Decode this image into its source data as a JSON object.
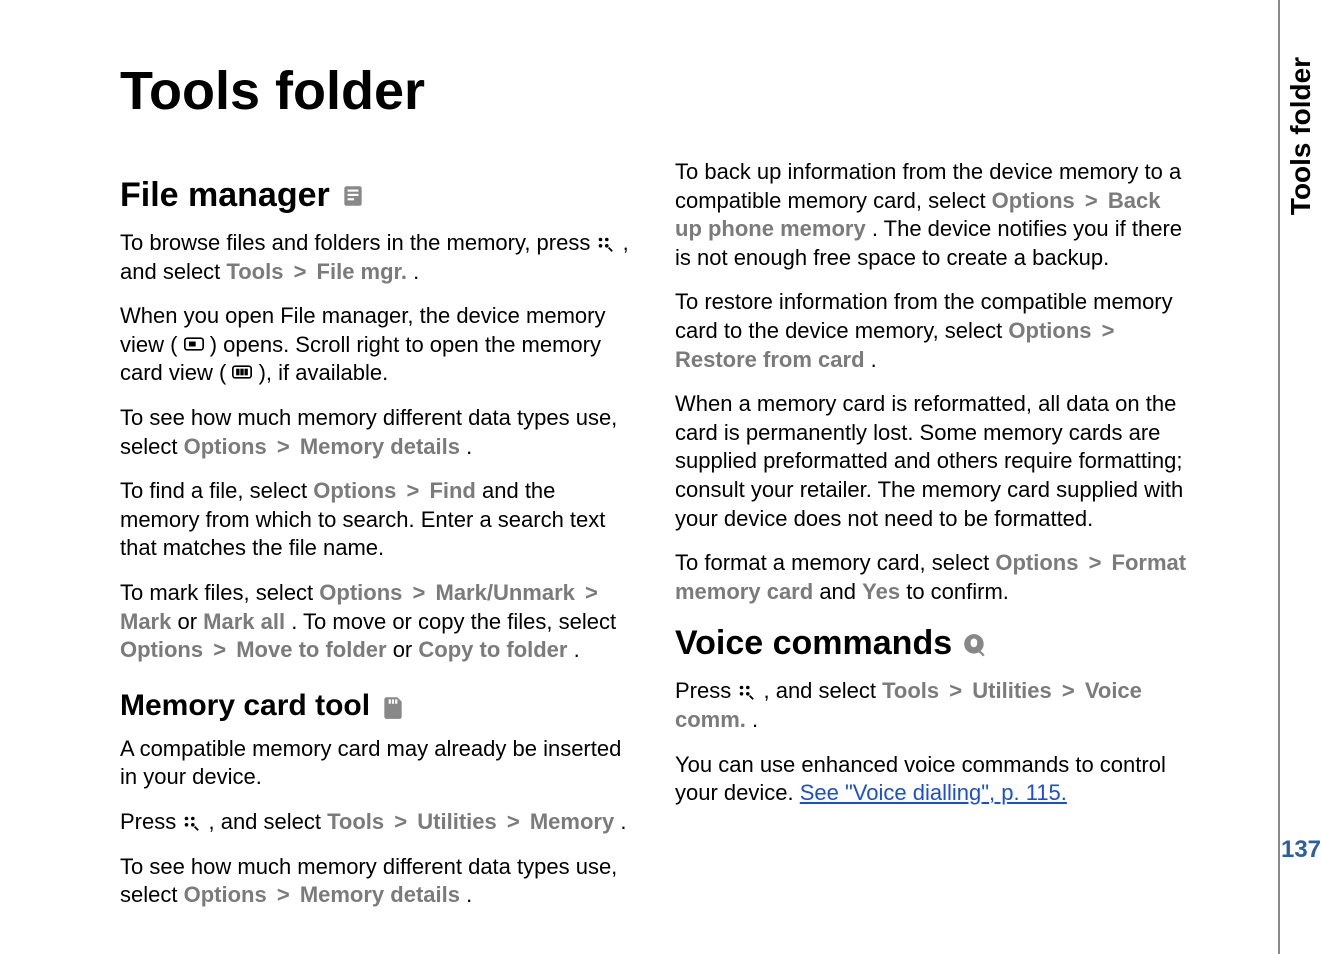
{
  "sidebar": {
    "label": "Tools folder",
    "page_number": "137"
  },
  "title": "Tools folder",
  "sections": {
    "file_manager": {
      "heading": "File manager"
    },
    "memory_card": {
      "heading": "Memory card tool"
    },
    "voice_commands": {
      "heading": "Voice commands"
    }
  },
  "menu": {
    "options": "Options",
    "tools": "Tools",
    "file_mgr": "File mgr.",
    "memory_details": "Memory details",
    "find": "Find",
    "mark_unmark": "Mark/Unmark",
    "mark": "Mark",
    "mark_all": "Mark all",
    "move_to_folder": "Move to folder",
    "copy_to_folder": "Copy to folder",
    "utilities": "Utilities",
    "memory": "Memory",
    "back_up_phone_memory": "Back up phone memory",
    "restore_from_card": "Restore from card",
    "format_memory_card": "Format memory card",
    "yes": "Yes",
    "voice_comm": "Voice comm."
  },
  "text": {
    "fm_p1a": "To browse files and folders in the memory, press ",
    "fm_p1b": " , and select ",
    "fm_p1c": ".",
    "fm_p2a": "When you open File manager, the device memory view (",
    "fm_p2b": ") opens. Scroll right to open the memory card view (",
    "fm_p2c": "), if available.",
    "fm_p3a": "To see how much memory different data types use, select ",
    "fm_p3b": ".",
    "fm_p4a": "To find a file, select ",
    "fm_p4b": " and the memory from which to search. Enter a search text that matches the file name.",
    "fm_p5a": "To mark files, select ",
    "fm_p5b": " or ",
    "fm_p5c": ". To move or copy the files, select ",
    "fm_p5d": " or ",
    "fm_p5e": ".",
    "mc_p1": "A compatible memory card may already be inserted in your device.",
    "mc_p2a": "Press ",
    "mc_p2b": " , and select ",
    "mc_p2c": ".",
    "mc_p3a": "To see how much memory different data types use, select ",
    "mc_p3b": ".",
    "mc_p4a": "To back up information from the device memory to a compatible memory card, select ",
    "mc_p4b": ". The device notifies you if there is not enough free space to create a backup.",
    "mc_p5a": "To restore information from the compatible memory card to the device memory, select ",
    "mc_p5b": ".",
    "mc_p6": "When a memory card is reformatted, all data on the card is permanently lost. Some memory cards are supplied preformatted and others require formatting; consult your retailer. The memory card supplied with your device does not need to be formatted.",
    "mc_p7a": "To format a memory card, select ",
    "mc_p7b": " and ",
    "mc_p7c": " to confirm.",
    "vc_p1a": "Press ",
    "vc_p1b": " , and select ",
    "vc_p1c": ".",
    "vc_p2a": "You can use enhanced voice commands to control your device. ",
    "vc_link": "See \"Voice dialling\", p. 115."
  },
  "gt": ">"
}
